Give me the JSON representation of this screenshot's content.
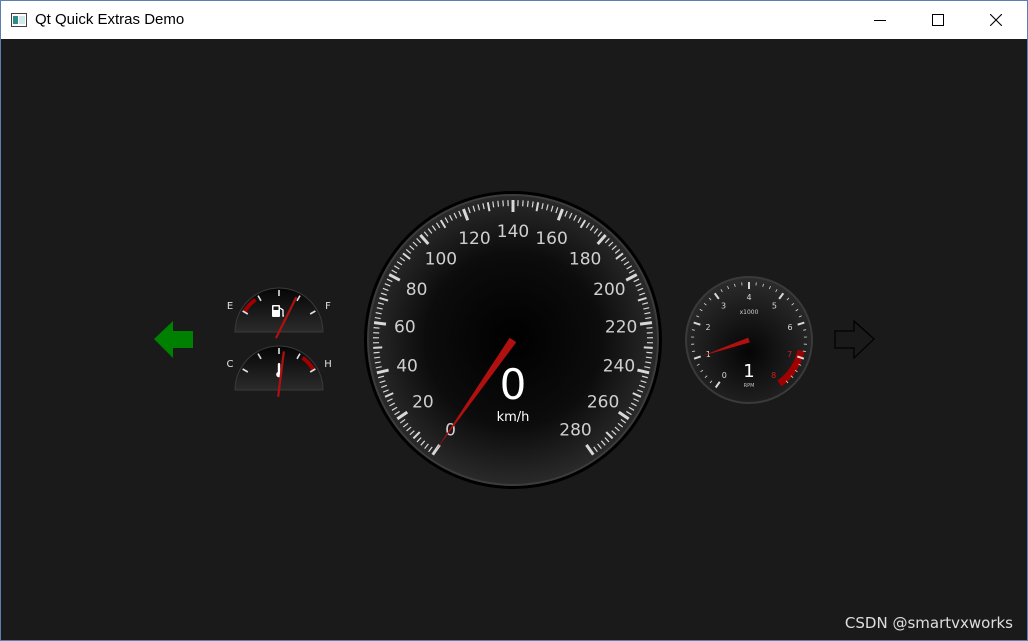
{
  "window": {
    "title": "Qt Quick Extras Demo"
  },
  "speedometer": {
    "value": 0,
    "unit": "km/h",
    "min": 0,
    "max": 280,
    "labels": [
      "0",
      "20",
      "40",
      "60",
      "80",
      "100",
      "120",
      "140",
      "160",
      "180",
      "200",
      "220",
      "240",
      "260",
      "280"
    ]
  },
  "tachometer": {
    "value": 1,
    "unit_label": "RPM",
    "multiplier_label": "x1000",
    "labels": [
      "0",
      "1",
      "2",
      "3",
      "4",
      "5",
      "6",
      "7",
      "8"
    ]
  },
  "fuel_gauge": {
    "empty_label": "E",
    "full_label": "F",
    "level": 0.72
  },
  "temp_gauge": {
    "cold_label": "C",
    "hot_label": "H",
    "level": 0.56
  },
  "turn_signals": {
    "left_active": true,
    "right_active": false
  },
  "colors": {
    "left_indicator": "#008000",
    "needle": "#b01010",
    "redline": "#a00000",
    "label": "#cfcfcf"
  },
  "watermark": "CSDN @smartvxworks"
}
